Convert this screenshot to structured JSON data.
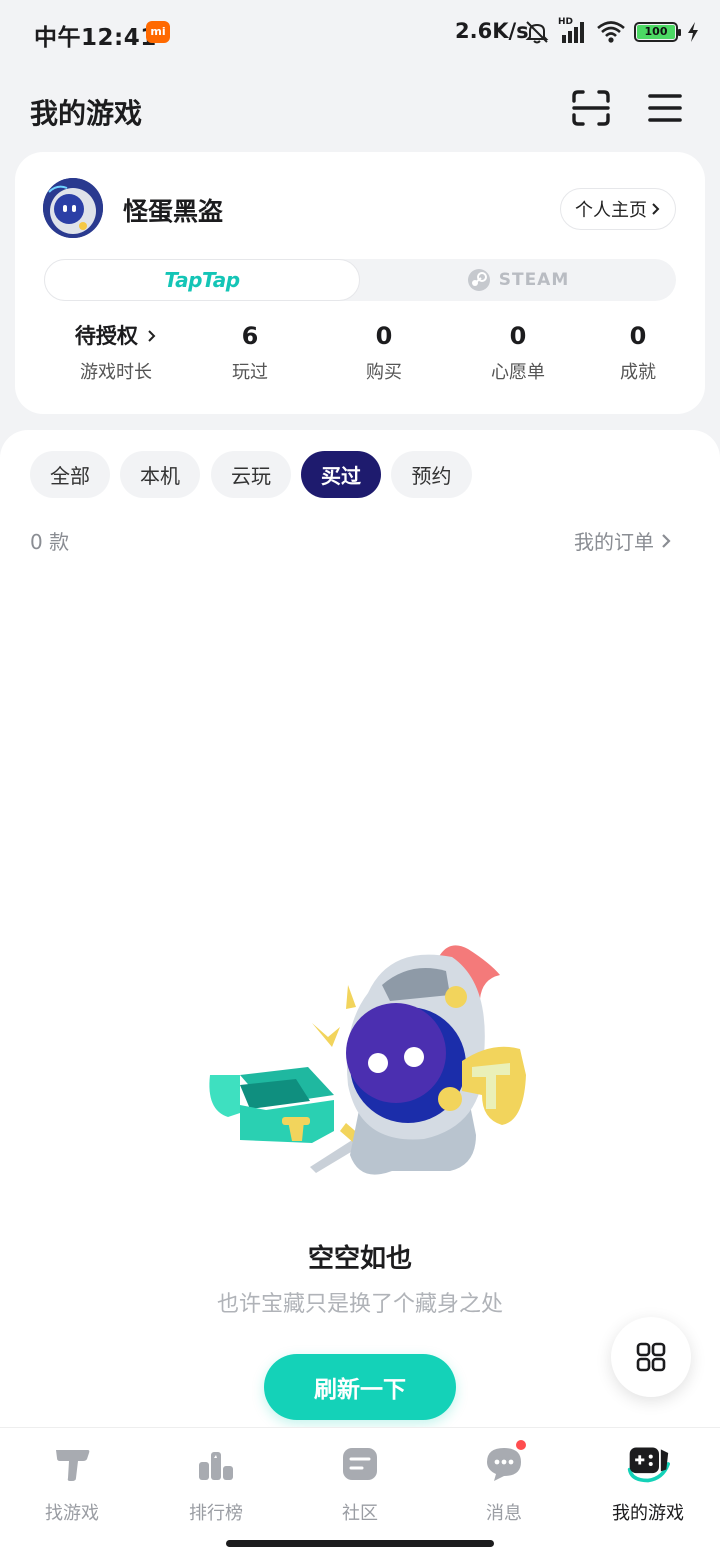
{
  "status_bar": {
    "time": "中午12:41",
    "mi_badge": "mi",
    "net_speed": "2.6K/s",
    "hd_label": "HD",
    "battery": "100"
  },
  "header": {
    "title": "我的游戏",
    "scan_icon": "scan-icon",
    "menu_icon": "menu-icon"
  },
  "profile": {
    "username": "怪蛋黑盗",
    "profile_link": "个人主页",
    "platforms": {
      "active": "TapTap",
      "inactive": "STEAM"
    },
    "stats": [
      {
        "value": "待授权",
        "label": "游戏时长"
      },
      {
        "value": "6",
        "label": "玩过"
      },
      {
        "value": "0",
        "label": "购买"
      },
      {
        "value": "0",
        "label": "心愿单"
      },
      {
        "value": "0",
        "label": "成就"
      }
    ]
  },
  "filters": {
    "chips": [
      "全部",
      "本机",
      "云玩",
      "买过",
      "预约"
    ],
    "selected": "买过",
    "count": "0 款",
    "orders_link": "我的订单"
  },
  "empty_state": {
    "title": "空空如也",
    "subtitle": "也许宝藏只是换了个藏身之处",
    "button": "刷新一下"
  },
  "fab_icon": "grid-icon",
  "bottom_nav": {
    "items": [
      {
        "label": "找游戏",
        "icon": "taptap-icon"
      },
      {
        "label": "排行榜",
        "icon": "ranking-icon"
      },
      {
        "label": "社区",
        "icon": "community-icon"
      },
      {
        "label": "消息",
        "icon": "message-icon"
      },
      {
        "label": "我的游戏",
        "icon": "gamepad-icon"
      }
    ],
    "active": "我的游戏"
  },
  "colors": {
    "accent": "#14d2b8",
    "chip_active": "#1e1b6e",
    "notification_dot": "#ff4d4f"
  }
}
